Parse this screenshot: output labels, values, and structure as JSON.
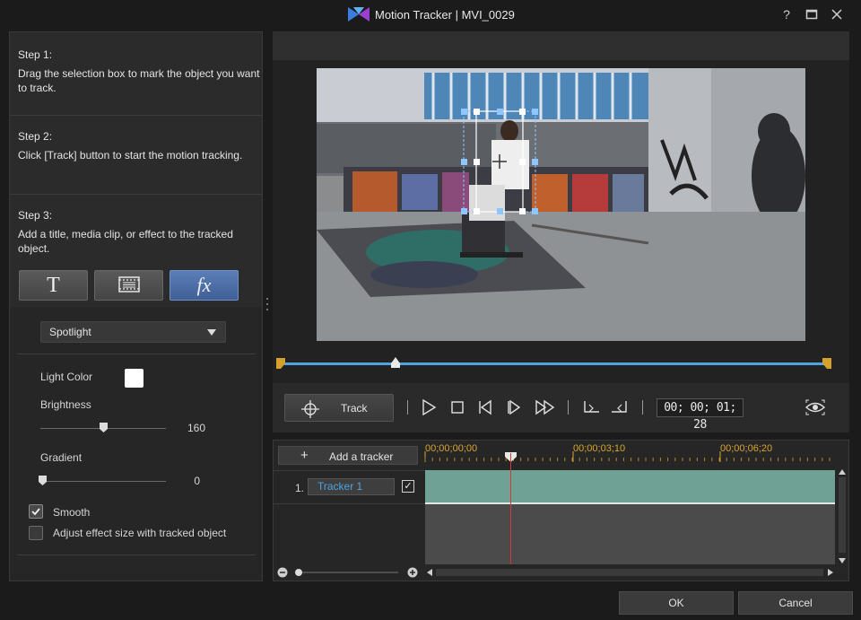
{
  "window": {
    "title": "Motion Tracker  |  MVI_0029",
    "help": "?",
    "maximize": "□",
    "close": "✕"
  },
  "steps": [
    {
      "title": "Step 1:",
      "desc": "Drag the selection box to mark the object you want to track."
    },
    {
      "title": "Step 2:",
      "desc": "Click [Track] button to start the motion tracking."
    },
    {
      "title": "Step 3:",
      "desc": "Add a title, media clip, or effect to the tracked object."
    }
  ],
  "object_buttons": {
    "title_glyph": "T",
    "fx_glyph": "fx"
  },
  "effect": {
    "selected": "Spotlight",
    "light_color_label": "Light Color",
    "light_color": "#ffffff",
    "brightness_label": "Brightness",
    "brightness_value": "160",
    "brightness_level": 0.5,
    "gradient_label": "Gradient",
    "gradient_value": "0",
    "gradient_level": 0.0,
    "smooth_label": "Smooth",
    "smooth_checked": true,
    "adjust_label": "Adjust effect size with tracked object",
    "adjust_checked": false
  },
  "controls": {
    "track_label": "Track",
    "timecode": "00; 00; 01; 28"
  },
  "timeline": {
    "add_tracker_label": "Add a tracker",
    "ruler": [
      "00;00;00;00",
      "00;00;03;10",
      "00;00;06;20"
    ],
    "trackers": [
      {
        "index": "1.",
        "name": "Tracker 1",
        "checked": "✓"
      }
    ]
  },
  "dialog": {
    "ok": "OK",
    "cancel": "Cancel"
  },
  "colors": {
    "accent": "#4ea3e0",
    "clip": "#6fa195",
    "ruler": "#d9a62e",
    "playhead": "#d23a3a",
    "active_button": "#4f71a8"
  }
}
